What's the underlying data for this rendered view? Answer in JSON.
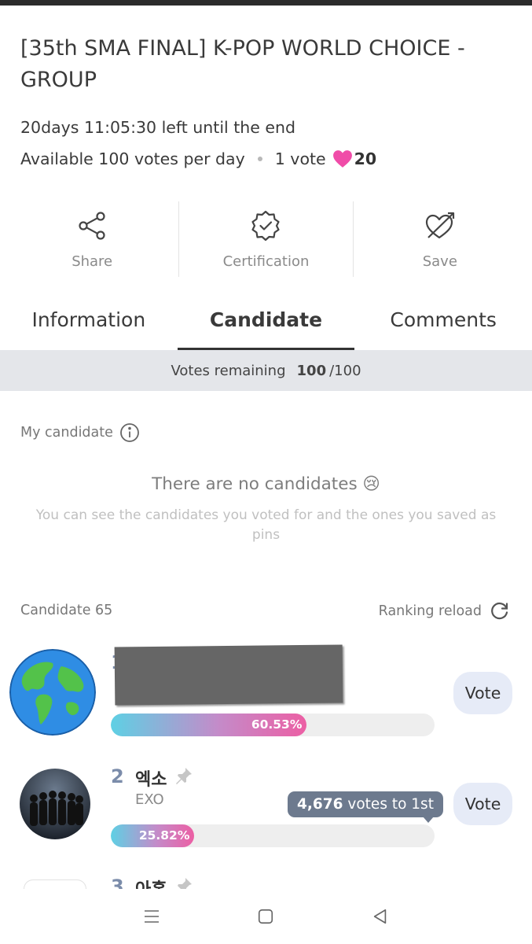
{
  "page": {
    "title": "[35th SMA FINAL] K-POP WORLD CHOICE - GROUP",
    "deadline": "20days 11:05:30 left until the end",
    "available": "Available 100 votes per day",
    "vote_unit": "1 vote",
    "heart_count": "20",
    "accent_pink": "#f04ca8"
  },
  "actions": [
    {
      "label": "Share",
      "icon": "share-icon"
    },
    {
      "label": "Certification",
      "icon": "certification-badge-icon"
    },
    {
      "label": "Save",
      "icon": "heart-arrow-icon"
    }
  ],
  "tabs": [
    {
      "label": "Information",
      "active": false
    },
    {
      "label": "Candidate",
      "active": true
    },
    {
      "label": "Comments",
      "active": false
    }
  ],
  "votes_remaining": {
    "label": "Votes remaining",
    "current": "100",
    "total": "/100"
  },
  "my_candidate": {
    "label": "My candidate",
    "empty_title": "There are no candidates 😢",
    "empty_sub": "You can see the candidates you voted for and the ones you saved as pins"
  },
  "candidates_header": {
    "label": "Candidate 65",
    "reload": "Ranking reload"
  },
  "candidates": [
    {
      "rank": "1",
      "name": "",
      "sub": "",
      "percent_label": "60.53%",
      "percent": 60.53,
      "vote_label": "Vote",
      "redacted": true
    },
    {
      "rank": "2",
      "name": "엑소",
      "sub": "EXO",
      "percent_label": "25.82%",
      "percent": 25.82,
      "vote_label": "Vote",
      "tooltip_num": "4,676",
      "tooltip_text": " votes to 1st"
    },
    {
      "rank": "3",
      "name": "아홉",
      "sub": ""
    }
  ]
}
